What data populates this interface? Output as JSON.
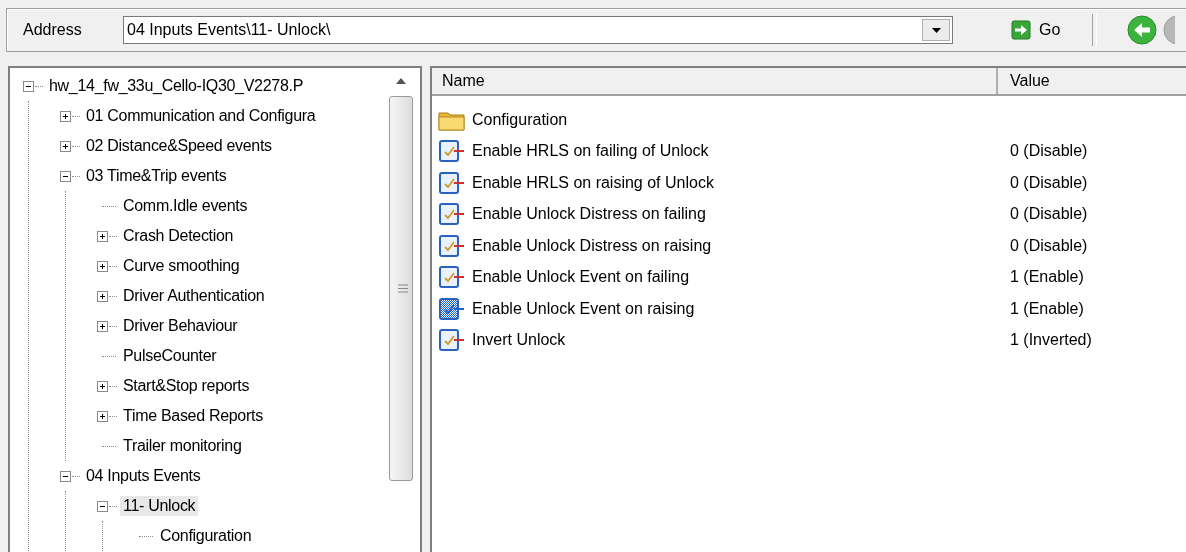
{
  "address_bar": {
    "label": "Address",
    "value": "04 Inputs Events\\11- Unlock\\",
    "go_button": "Go"
  },
  "tree": [
    {
      "label": "hw_14_fw_33u_Cello-IQ30_V2278.P",
      "kind": "group",
      "expanded": true,
      "selected": false,
      "children": [
        {
          "label": "01 Communication and Configura",
          "kind": "group",
          "expanded": false,
          "selected": false
        },
        {
          "label": "02 Distance&Speed events",
          "kind": "group",
          "expanded": false,
          "selected": false
        },
        {
          "label": "03 Time&Trip events",
          "kind": "group",
          "expanded": true,
          "selected": false,
          "children": [
            {
              "label": "Comm.Idle events",
              "kind": "leaf",
              "selected": false
            },
            {
              "label": "Crash Detection",
              "kind": "group",
              "expanded": false,
              "selected": false
            },
            {
              "label": "Curve smoothing",
              "kind": "group",
              "expanded": false,
              "selected": false
            },
            {
              "label": "Driver Authentication",
              "kind": "group",
              "expanded": false,
              "selected": false
            },
            {
              "label": "Driver Behaviour",
              "kind": "group",
              "expanded": false,
              "selected": false
            },
            {
              "label": "PulseCounter",
              "kind": "leaf",
              "selected": false
            },
            {
              "label": "Start&Stop reports",
              "kind": "group",
              "expanded": false,
              "selected": false
            },
            {
              "label": "Time Based Reports",
              "kind": "group",
              "expanded": false,
              "selected": false
            },
            {
              "label": "Trailer monitoring",
              "kind": "leaf",
              "selected": false
            }
          ]
        },
        {
          "label": "04 Inputs Events",
          "kind": "group",
          "expanded": true,
          "selected": false,
          "children": [
            {
              "label": "11- Unlock",
              "kind": "group",
              "expanded": true,
              "selected": true,
              "children": [
                {
                  "label": "Configuration",
                  "kind": "leaf",
                  "selected": false
                }
              ]
            }
          ]
        }
      ]
    }
  ],
  "list": {
    "columns": [
      "Name",
      "Value"
    ],
    "rows": [
      {
        "name": "Configuration",
        "kind": "folder",
        "selected": false
      },
      {
        "name": "Enable HRLS on failing of Unlock",
        "value": "0 (Disable)",
        "kind": "setting",
        "selected": false
      },
      {
        "name": "Enable HRLS on raising of Unlock",
        "value": "0 (Disable)",
        "kind": "setting",
        "selected": false
      },
      {
        "name": "Enable Unlock Distress on failing",
        "value": "0 (Disable)",
        "kind": "setting",
        "selected": false
      },
      {
        "name": "Enable Unlock Distress on raising",
        "value": "0 (Disable)",
        "kind": "setting",
        "selected": false
      },
      {
        "name": "Enable Unlock Event on failing",
        "value": "1 (Enable)",
        "kind": "setting",
        "selected": false
      },
      {
        "name": "Enable Unlock Event on raising",
        "value": "1 (Enable)",
        "kind": "setting",
        "selected": true
      },
      {
        "name": "Invert Unlock",
        "value": "1 (Inverted)",
        "kind": "setting",
        "selected": false
      }
    ]
  }
}
